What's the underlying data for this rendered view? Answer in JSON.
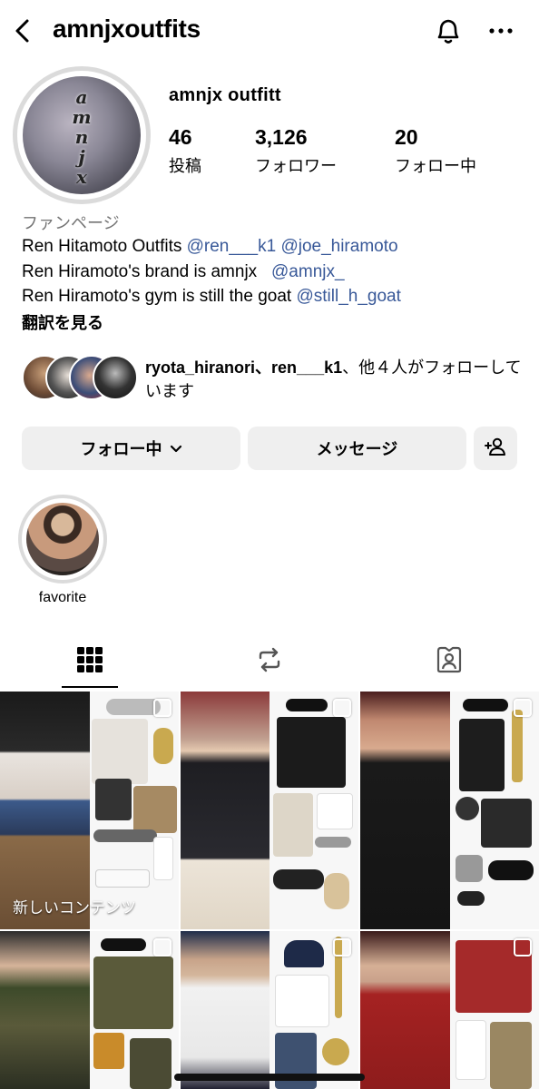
{
  "header": {
    "username": "amnjxoutfits"
  },
  "profile": {
    "avatar_letters": [
      "a",
      "m",
      "n",
      "j",
      "x"
    ],
    "display_name": "amnjx  outfitt",
    "stats": [
      {
        "value": "46",
        "label": "投稿"
      },
      {
        "value": "3,126",
        "label": "フォロワー"
      },
      {
        "value": "20",
        "label": "フォロー中"
      }
    ],
    "category": "ファンページ",
    "bio": [
      {
        "text": "Ren Hitamoto Outfits ",
        "mentions": [
          "@ren___k1",
          "@joe_hiramoto"
        ]
      },
      {
        "text": "Ren Hiramoto's brand is amnjx   ",
        "mentions": [
          "@amnjx_"
        ]
      },
      {
        "text": "Ren Hiramoto's gym is still the goat ",
        "mentions": [
          "@still_h_goat"
        ]
      }
    ],
    "translate": "翻訳を見る",
    "mutual": {
      "names": "ryota_hiranori、ren___k1",
      "suffix": "、他４人がフォローしています"
    }
  },
  "actions": {
    "follow_label": "フォロー中",
    "message_label": "メッセージ"
  },
  "highlight": {
    "label": "favorite"
  },
  "tabs": [
    "grid-icon",
    "reels-repost-icon",
    "tagged-icon"
  ],
  "grid": {
    "new_content_label": "新しいコンテンツ"
  },
  "colors": {
    "mention": "#385898",
    "button_bg": "#efefef",
    "ring": "#dbdbdb"
  }
}
